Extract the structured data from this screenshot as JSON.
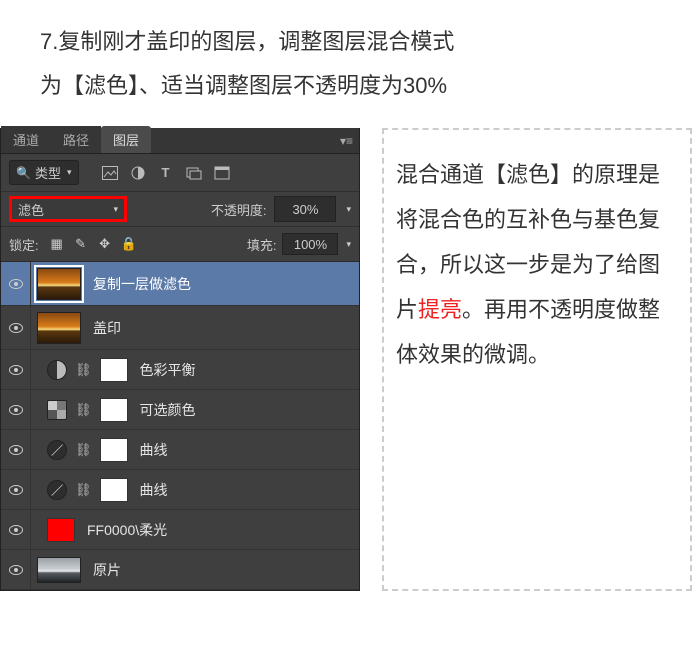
{
  "instruction": {
    "line1": "7.复制刚才盖印的图层，调整图层混合模式",
    "line2": "为【滤色】、适当调整图层不透明度为30%"
  },
  "panel": {
    "tabs": {
      "channels": "通道",
      "paths": "路径",
      "layers": "图层"
    },
    "filter": {
      "kind_label": "类型",
      "icon_image_alt": "image-filter",
      "icon_adjust_alt": "adjust-filter",
      "icon_text_label": "T",
      "icon_shape_alt": "shape-filter",
      "icon_smart_alt": "smart-filter"
    },
    "blend": {
      "mode": "滤色",
      "opacity_label": "不透明度:",
      "opacity_value": "30%"
    },
    "lock": {
      "label": "锁定:",
      "fill_label": "填充:",
      "fill_value": "100%"
    },
    "layers": [
      {
        "name": "复制一层做滤色",
        "kind": "raster",
        "thumb": "sunset",
        "selected": true
      },
      {
        "name": "盖印",
        "kind": "raster",
        "thumb": "sunset"
      },
      {
        "name": "色彩平衡",
        "kind": "adjust",
        "icon": "circle-half"
      },
      {
        "name": "可选颜色",
        "kind": "adjust",
        "icon": "boxes"
      },
      {
        "name": "曲线",
        "kind": "adjust",
        "icon": "curve"
      },
      {
        "name": "曲线",
        "kind": "adjust",
        "icon": "curve"
      },
      {
        "name": "FF0000\\柔光",
        "kind": "color-fill"
      },
      {
        "name": "原片",
        "kind": "raster",
        "thumb": "gray"
      }
    ]
  },
  "explanation": {
    "p1a": "混合通道【滤色】的原理是将混合色的互补色与基色复合，所以这一步是为了给图片",
    "p1_hl": "提亮",
    "p1b": "。再用不透明度做整体效果的微调。"
  }
}
